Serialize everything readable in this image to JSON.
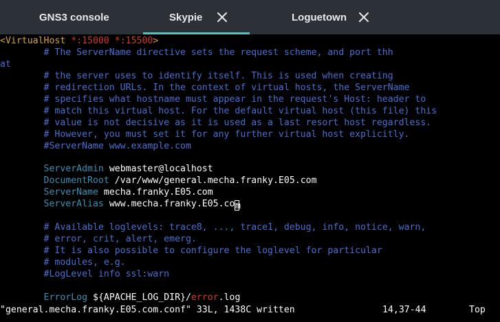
{
  "tabs": [
    {
      "label": "GNS3 console",
      "closable": false,
      "active": false
    },
    {
      "label": "Skypie",
      "closable": true,
      "active": true
    },
    {
      "label": "Loguetown",
      "closable": true,
      "active": false
    }
  ],
  "colors": {
    "tabbar_bg": "#2b3137",
    "active_indicator": "#5bc0be",
    "comment": "#4a6fd1",
    "directive": "#3f8fb6",
    "tag": "#d4a53a",
    "error_keyword": "#d03a2a"
  },
  "icons": {
    "tab_close": "close-icon"
  },
  "editor": {
    "vhost_open": {
      "tag": "<VirtualHost",
      "addr1": "*:15000",
      "addr2": "*:15500",
      "close": ">"
    },
    "comment_block_1": [
      "        # The ServerName directive sets the request scheme, and port thhat",
      "        # the server uses to identify itself. This is used when creating",
      "        # redirection URLs. In the context of virtual hosts, the ServerName",
      "        # specifies what hostname must appear in the request's Host: header to",
      "        # match this virtual host. For the default virtual host (this file) this",
      "        # value is not decisive as it is used as a last resort host regardless.",
      "        # However, you must set it for any further virtual host explicitly.",
      "        #ServerName www.example.com"
    ],
    "directives": [
      {
        "name": "ServerAdmin",
        "value": "webmaster@localhost"
      },
      {
        "name": "DocumentRoot",
        "value": "/var/www/general.mecha.franky.E05.com"
      },
      {
        "name": "ServerName",
        "value": "mecha.franky.E05.com"
      },
      {
        "name": "ServerAlias",
        "value_before_cursor": "www.mecha.franky.E05.co",
        "cursor_char": "m"
      }
    ],
    "comment_block_2": [
      "        # Available loglevels: trace8, ..., trace1, debug, info, notice, warn,",
      "        # error, crit, alert, emerg.",
      "        # It is also possible to configure the loglevel for particular",
      "        # modules, e.g.",
      "        #LogLevel info ssl:warn"
    ],
    "errorlog": {
      "name": "ErrorLog",
      "var": "${APACHE_LOG_DIR}/",
      "keyword": "error",
      "suffix": ".log"
    }
  },
  "status_line": {
    "message": "\"general.mecha.franky.E05.com.conf\" 33L, 1438C written",
    "position": "14,37-44",
    "scroll": "Top"
  }
}
